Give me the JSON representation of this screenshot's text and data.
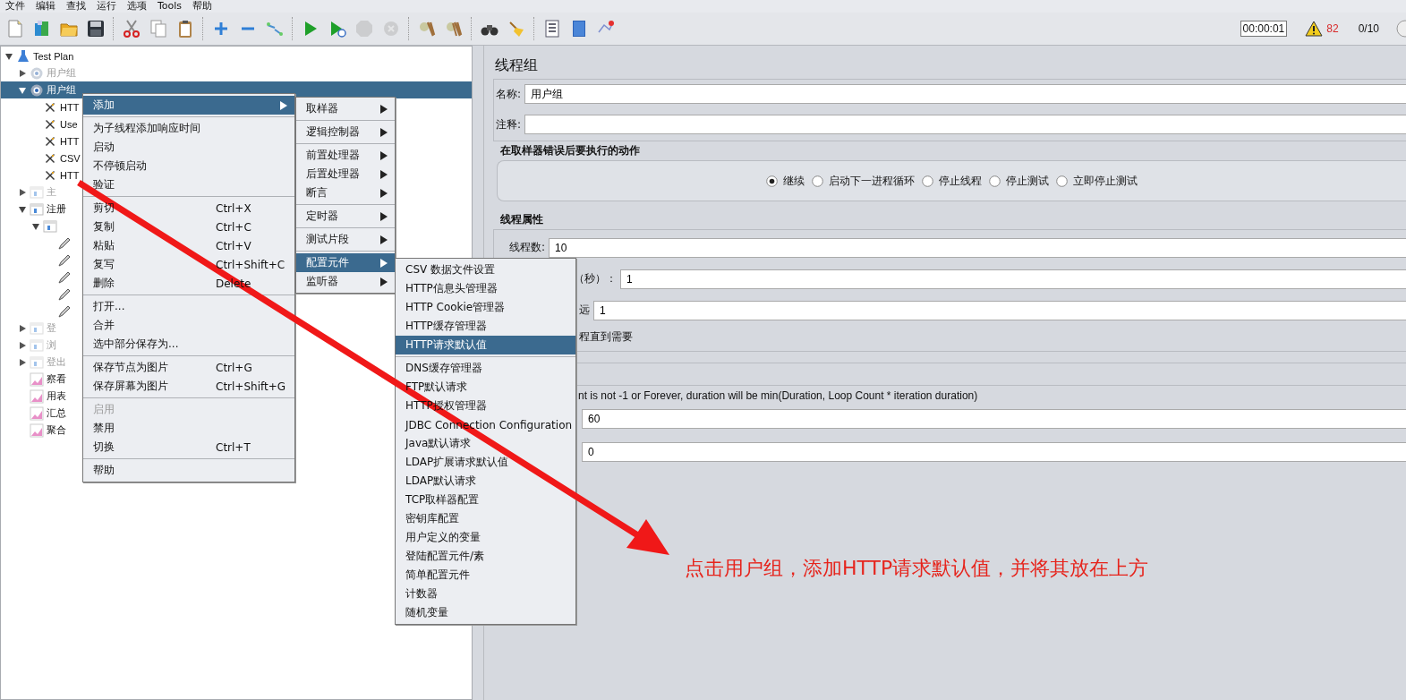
{
  "menu_bar": [
    "文件",
    "编辑",
    "查找",
    "运行",
    "选项",
    "Tools",
    "帮助"
  ],
  "toolbar": [
    [
      {
        "kind": "new",
        "disabled": false
      },
      {
        "kind": "templates",
        "disabled": false
      },
      {
        "kind": "open",
        "disabled": false
      },
      {
        "kind": "save",
        "disabled": false
      }
    ],
    [
      {
        "kind": "cut",
        "disabled": false
      },
      {
        "kind": "copy",
        "disabled": false
      },
      {
        "kind": "paste",
        "disabled": false
      }
    ],
    [
      {
        "kind": "expand",
        "disabled": false
      },
      {
        "kind": "collapse",
        "disabled": false
      },
      {
        "kind": "toggle",
        "disabled": false
      }
    ],
    [
      {
        "kind": "start",
        "disabled": false
      },
      {
        "kind": "start_no_pause",
        "disabled": false
      },
      {
        "kind": "stop",
        "disabled": true
      },
      {
        "kind": "shutdown",
        "disabled": true
      }
    ],
    [
      {
        "kind": "clear",
        "disabled": false
      },
      {
        "kind": "clear_all",
        "disabled": false
      }
    ],
    [
      {
        "kind": "search",
        "disabled": false
      },
      {
        "kind": "reset",
        "disabled": false
      }
    ],
    [
      {
        "kind": "functions",
        "disabled": false
      },
      {
        "kind": "help",
        "disabled": false
      },
      {
        "kind": "remote",
        "disabled": false
      }
    ]
  ],
  "status": {
    "timer": "00:00:01",
    "warnings": "82",
    "threads": "0/10"
  },
  "tree": [
    {
      "kind": "plan",
      "label": "Test Plan",
      "expanded": true,
      "selected": false,
      "disabled": false,
      "children": [
        {
          "kind": "thread_group",
          "label": "用户组",
          "expanded": false,
          "selected": false,
          "disabled": true
        },
        {
          "kind": "thread_group",
          "label": "用户组",
          "expanded": true,
          "selected": true,
          "disabled": false,
          "children": [
            {
              "kind": "config",
              "label": "HTT",
              "selected": false,
              "disabled": false
            },
            {
              "kind": "config",
              "label": "Use",
              "selected": false,
              "disabled": false
            },
            {
              "kind": "config",
              "label": "HTT",
              "selected": false,
              "disabled": false
            },
            {
              "kind": "config",
              "label": "CSV",
              "selected": false,
              "disabled": false
            },
            {
              "kind": "config",
              "label": "HTT",
              "selected": false,
              "disabled": false
            }
          ]
        },
        {
          "kind": "controller",
          "label": "主",
          "expanded": false,
          "selected": false,
          "disabled": true
        },
        {
          "kind": "controller",
          "label": "注册",
          "expanded": true,
          "selected": false,
          "disabled": false,
          "children": [
            {
              "kind": "controller",
              "expanded": true,
              "selected": false,
              "disabled": false,
              "children": [
                {
                  "kind": "sampler",
                  "selected": false,
                  "disabled": false
                },
                {
                  "kind": "sampler",
                  "selected": false,
                  "disabled": false
                },
                {
                  "kind": "sampler",
                  "selected": false,
                  "disabled": false
                },
                {
                  "kind": "sampler",
                  "selected": false,
                  "disabled": false
                },
                {
                  "kind": "sampler",
                  "selected": false,
                  "disabled": false
                }
              ]
            }
          ]
        },
        {
          "kind": "controller",
          "label": "登",
          "expanded": false,
          "selected": false,
          "disabled": true
        },
        {
          "kind": "controller",
          "label": "浏",
          "expanded": false,
          "selected": false,
          "disabled": true
        },
        {
          "kind": "controller",
          "label": "登出",
          "expanded": false,
          "selected": false,
          "disabled": true
        },
        {
          "kind": "listener",
          "label": "察看",
          "selected": false,
          "disabled": false
        },
        {
          "kind": "listener",
          "label": "用表",
          "selected": false,
          "disabled": false
        },
        {
          "kind": "listener",
          "label": "汇总",
          "selected": false,
          "disabled": false
        },
        {
          "kind": "listener",
          "label": "聚合",
          "selected": false,
          "disabled": false
        }
      ]
    }
  ],
  "context_menu": [
    [
      {
        "label": "添加",
        "submenu": true,
        "selected": true,
        "disabled": false
      }
    ],
    [
      {
        "label": "为子线程添加响应时间",
        "submenu": false,
        "selected": false,
        "disabled": false
      },
      {
        "label": "启动",
        "submenu": false,
        "selected": false,
        "disabled": false
      },
      {
        "label": "不停顿启动",
        "submenu": false,
        "selected": false,
        "disabled": false
      },
      {
        "label": "验证",
        "submenu": false,
        "selected": false,
        "disabled": false
      }
    ],
    [
      {
        "label": "剪切",
        "shortcut": "Ctrl+X",
        "submenu": false,
        "selected": false,
        "disabled": false
      },
      {
        "label": "复制",
        "shortcut": "Ctrl+C",
        "submenu": false,
        "selected": false,
        "disabled": false
      },
      {
        "label": "粘贴",
        "shortcut": "Ctrl+V",
        "submenu": false,
        "selected": false,
        "disabled": false
      },
      {
        "label": "复写",
        "shortcut": "Ctrl+Shift+C",
        "submenu": false,
        "selected": false,
        "disabled": false
      },
      {
        "label": "删除",
        "shortcut": "Delete",
        "submenu": false,
        "selected": false,
        "disabled": false
      }
    ],
    [
      {
        "label": "打开...",
        "submenu": false,
        "selected": false,
        "disabled": false
      },
      {
        "label": "合并",
        "submenu": false,
        "selected": false,
        "disabled": false
      },
      {
        "label": "选中部分保存为...",
        "submenu": false,
        "selected": false,
        "disabled": false
      }
    ],
    [
      {
        "label": "保存节点为图片",
        "shortcut": "Ctrl+G",
        "submenu": false,
        "selected": false,
        "disabled": false
      },
      {
        "label": "保存屏幕为图片",
        "shortcut": "Ctrl+Shift+G",
        "submenu": false,
        "selected": false,
        "disabled": false
      }
    ],
    [
      {
        "label": "启用",
        "submenu": false,
        "selected": false,
        "disabled": true
      },
      {
        "label": "禁用",
        "submenu": false,
        "selected": false,
        "disabled": false
      },
      {
        "label": "切换",
        "shortcut": "Ctrl+T",
        "submenu": false,
        "selected": false,
        "disabled": false
      }
    ],
    [
      {
        "label": "帮助",
        "submenu": false,
        "selected": false,
        "disabled": false
      }
    ]
  ],
  "add_submenu": [
    [
      {
        "label": "取样器",
        "submenu": true,
        "selected": false
      }
    ],
    [
      {
        "label": "逻辑控制器",
        "submenu": true,
        "selected": false
      }
    ],
    [
      {
        "label": "前置处理器",
        "submenu": true,
        "selected": false
      },
      {
        "label": "后置处理器",
        "submenu": true,
        "selected": false
      },
      {
        "label": "断言",
        "submenu": true,
        "selected": false
      }
    ],
    [
      {
        "label": "定时器",
        "submenu": true,
        "selected": false
      }
    ],
    [
      {
        "label": "测试片段",
        "submenu": true,
        "selected": false
      }
    ],
    [
      {
        "label": "配置元件",
        "submenu": true,
        "selected": true
      },
      {
        "label": "监听器",
        "submenu": true,
        "selected": false
      }
    ]
  ],
  "config_submenu": [
    [
      {
        "label": "CSV 数据文件设置",
        "selected": false
      },
      {
        "label": "HTTP信息头管理器",
        "selected": false
      },
      {
        "label": "HTTP Cookie管理器",
        "selected": false
      },
      {
        "label": "HTTP缓存管理器",
        "selected": false
      },
      {
        "label": "HTTP请求默认值",
        "selected": true
      }
    ],
    [
      {
        "label": "DNS缓存管理器",
        "selected": false
      },
      {
        "label": "FTP默认请求",
        "selected": false
      },
      {
        "label": "HTTP授权管理器",
        "selected": false
      },
      {
        "label": "JDBC Connection Configuration",
        "selected": false
      },
      {
        "label": "Java默认请求",
        "selected": false
      },
      {
        "label": "LDAP扩展请求默认值",
        "selected": false
      },
      {
        "label": "LDAP默认请求",
        "selected": false
      },
      {
        "label": "TCP取样器配置",
        "selected": false
      },
      {
        "label": "密钥库配置",
        "selected": false
      },
      {
        "label": "用户定义的变量",
        "selected": false
      },
      {
        "label": "登陆配置元件/素",
        "selected": false
      },
      {
        "label": "简单配置元件",
        "selected": false
      },
      {
        "label": "计数器",
        "selected": false
      },
      {
        "label": "随机变量",
        "selected": false
      }
    ]
  ],
  "panel": {
    "title": "线程组",
    "name": {
      "label": "名称:",
      "value": "用户组"
    },
    "comment": {
      "label": "注释:"
    },
    "error_action": {
      "title": "在取样器错误后要执行的动作",
      "options": [
        {
          "label": "继续",
          "selected": true
        },
        {
          "label": "启动下一进程循环",
          "selected": false
        },
        {
          "label": "停止线程",
          "selected": false
        },
        {
          "label": "停止测试",
          "selected": false
        },
        {
          "label": "立即停止测试",
          "selected": false
        }
      ]
    },
    "thread_props": {
      "title": "线程属性",
      "rows": [
        {
          "label": "线程数:",
          "value": "10"
        },
        {
          "label": "（秒）：",
          "value": "1"
        },
        {
          "label": "远",
          "value": "1"
        }
      ],
      "delay_label": "程直到需要"
    },
    "duration_note": "nt is not -1 or Forever, duration will be min(Duration, Loop Count * iteration duration)",
    "duration_rows": [
      {
        "value": "60"
      },
      {
        "value": "0"
      }
    ]
  },
  "annotation": {
    "text": "点击用户组，添加HTTP请求默认值，并将其放在上方"
  }
}
